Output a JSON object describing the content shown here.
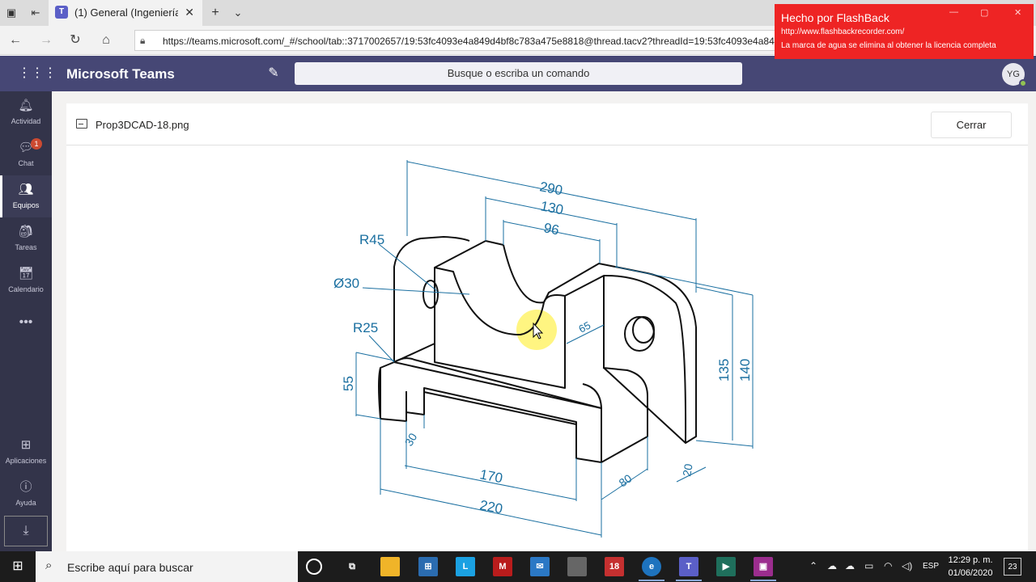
{
  "browser": {
    "tab_title": "(1) General (Ingeniería c",
    "url": "https://teams.microsoft.com/_#/school/tab::3717002657/19:53fc4093e4a849d4bf8c783a475e8818@thread.tacv2?threadId=19:53fc4093e4a849d4bf8c783a475"
  },
  "watermark": {
    "title": "Hecho por FlashBack",
    "url": "http://www.flashbackrecorder.com/",
    "note": "La marca de agua se elimina al obtener la licencia completa"
  },
  "teams": {
    "app_title": "Microsoft Teams",
    "search_placeholder": "Busque o escriba un comando",
    "avatar_initials": "YG"
  },
  "rail": {
    "items": [
      {
        "label": "Actividad",
        "icon": "bell-icon"
      },
      {
        "label": "Chat",
        "icon": "chat-icon",
        "badge": "1"
      },
      {
        "label": "Equipos",
        "icon": "teams-icon",
        "active": true
      },
      {
        "label": "Tareas",
        "icon": "assignments-icon"
      },
      {
        "label": "Calendario",
        "icon": "calendar-icon"
      }
    ],
    "more": "•••",
    "apps_label": "Aplicaciones",
    "help_label": "Ayuda"
  },
  "viewer": {
    "file_name": "Prop3DCAD-18.png",
    "close_label": "Cerrar"
  },
  "drawing": {
    "dimensions": [
      "290",
      "130",
      "96",
      "R45",
      "Ø30",
      "R25",
      "55",
      "65",
      "135",
      "140",
      "30",
      "170",
      "220",
      "80",
      "20"
    ]
  },
  "taskbar": {
    "search_text": "Escribe aquí para buscar",
    "language": "ESP",
    "time": "12:29 p. m.",
    "date": "01/06/2020",
    "notifications": "23"
  },
  "colors": {
    "teams_header": "#464775",
    "rail": "#33344a",
    "dimension_blue": "#1a6fa0",
    "watermark_red": "#ee2424",
    "highlight_yellow": "#fff36b"
  }
}
